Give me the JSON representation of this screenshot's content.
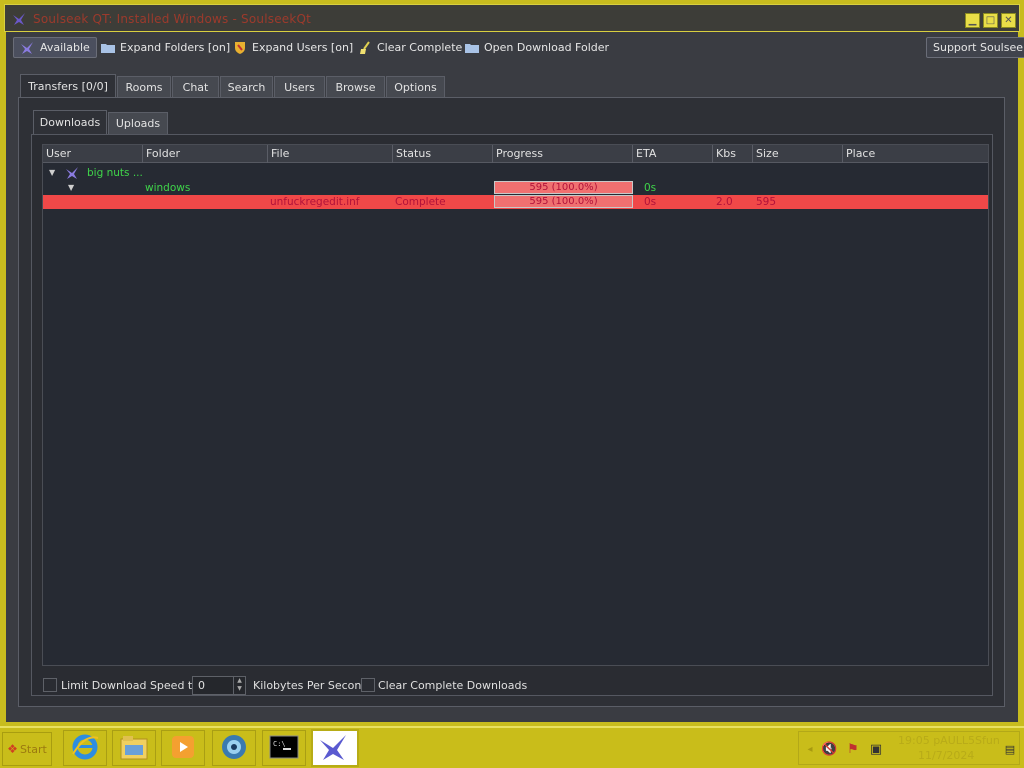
{
  "window": {
    "title": "Soulseek QT: Installed Windows - SoulseekQt",
    "buttons": [
      "minimize",
      "maximize",
      "close"
    ]
  },
  "toolbar": {
    "status_label": "Available",
    "expand_folders_label": "Expand Folders [on]",
    "expand_users_label": "Expand Users [on]",
    "clear_complete_label": "Clear Complete",
    "open_folder_label": "Open Download Folder",
    "support_label": "Support Soulseek!"
  },
  "tabs": [
    "Transfers [0/0]",
    "Rooms",
    "Chat",
    "Search",
    "Users",
    "Browse",
    "Options"
  ],
  "subtabs": [
    "Downloads",
    "Uploads"
  ],
  "table": {
    "columns": [
      "User",
      "Folder",
      "File",
      "Status",
      "Progress",
      "ETA",
      "Kbs",
      "Size",
      "Place"
    ],
    "user_row": {
      "user": "big nuts ..."
    },
    "folder_row": {
      "folder": "windows",
      "progress": "595 (100.0%)",
      "progress_fraction": 1.0,
      "eta": "0s"
    },
    "file_row": {
      "file": "unfuckregedit.inf",
      "status": "Complete",
      "progress": "595 (100.0%)",
      "progress_fraction": 1.0,
      "eta": "0s",
      "kbs": "2.0",
      "size": "595"
    }
  },
  "bottom": {
    "limit_label": "Limit Download Speed to",
    "speed_value": "0",
    "kbps_label": "Kilobytes Per Second",
    "clear_downloads_label": "Clear Complete Downloads"
  },
  "taskbar": {
    "start_label": "Start",
    "clock_time": "19:05 pAULL5Sfun",
    "clock_date": "11/7/2024"
  },
  "colors": {
    "accent_red": "#f04848",
    "green_text": "#3fd44a",
    "taskbar": "#c9bd1a"
  }
}
